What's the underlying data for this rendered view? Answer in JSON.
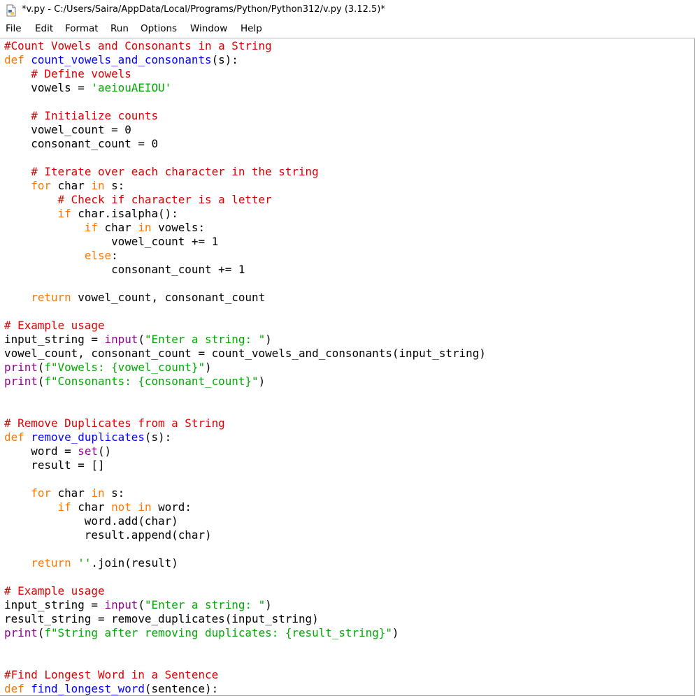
{
  "window": {
    "title": "*v.py - C:/Users/Saira/AppData/Local/Programs/Python/Python312/v.py (3.12.5)*",
    "icon": "python-file-icon"
  },
  "menu": {
    "items": [
      "File",
      "Edit",
      "Format",
      "Run",
      "Options",
      "Window",
      "Help"
    ]
  },
  "colors": {
    "keyword": "#ff7700",
    "comment": "#dd0000",
    "string": "#00aa00",
    "builtin": "#900090",
    "definition": "#0000ff",
    "text": "#000000"
  },
  "editor": {
    "lines": [
      [
        [
          "cm",
          "#Count Vowels and Consonants in a String"
        ]
      ],
      [
        [
          "kw",
          "def"
        ],
        [
          "pl",
          " "
        ],
        [
          "df",
          "count_vowels_and_consonants"
        ],
        [
          "pl",
          "(s):"
        ]
      ],
      [
        [
          "pl",
          "    "
        ],
        [
          "cm",
          "# Define vowels"
        ]
      ],
      [
        [
          "pl",
          "    vowels = "
        ],
        [
          "st",
          "'aeiouAEIOU'"
        ]
      ],
      [],
      [
        [
          "pl",
          "    "
        ],
        [
          "cm",
          "# Initialize counts"
        ]
      ],
      [
        [
          "pl",
          "    vowel_count = 0"
        ]
      ],
      [
        [
          "pl",
          "    consonant_count = 0"
        ]
      ],
      [],
      [
        [
          "pl",
          "    "
        ],
        [
          "cm",
          "# Iterate over each character in the string"
        ]
      ],
      [
        [
          "pl",
          "    "
        ],
        [
          "kw",
          "for"
        ],
        [
          "pl",
          " char "
        ],
        [
          "kw",
          "in"
        ],
        [
          "pl",
          " s:"
        ]
      ],
      [
        [
          "pl",
          "        "
        ],
        [
          "cm",
          "# Check if character is a letter"
        ]
      ],
      [
        [
          "pl",
          "        "
        ],
        [
          "kw",
          "if"
        ],
        [
          "pl",
          " char.isalpha():"
        ]
      ],
      [
        [
          "pl",
          "            "
        ],
        [
          "kw",
          "if"
        ],
        [
          "pl",
          " char "
        ],
        [
          "kw",
          "in"
        ],
        [
          "pl",
          " vowels:"
        ]
      ],
      [
        [
          "pl",
          "                vowel_count += 1"
        ]
      ],
      [
        [
          "pl",
          "            "
        ],
        [
          "kw",
          "else"
        ],
        [
          "pl",
          ":"
        ]
      ],
      [
        [
          "pl",
          "                consonant_count += 1"
        ]
      ],
      [],
      [
        [
          "pl",
          "    "
        ],
        [
          "kw",
          "return"
        ],
        [
          "pl",
          " vowel_count, consonant_count"
        ]
      ],
      [],
      [
        [
          "cm",
          "# Example usage"
        ]
      ],
      [
        [
          "pl",
          "input_string = "
        ],
        [
          "bi",
          "input"
        ],
        [
          "pl",
          "("
        ],
        [
          "st",
          "\"Enter a string: \""
        ],
        [
          "pl",
          ")"
        ]
      ],
      [
        [
          "pl",
          "vowel_count, consonant_count = count_vowels_and_consonants(input_string)"
        ]
      ],
      [
        [
          "bi",
          "print"
        ],
        [
          "pl",
          "("
        ],
        [
          "st",
          "f\"Vowels: {vowel_count}\""
        ],
        [
          "pl",
          ")"
        ]
      ],
      [
        [
          "bi",
          "print"
        ],
        [
          "pl",
          "("
        ],
        [
          "st",
          "f\"Consonants: {consonant_count}\""
        ],
        [
          "pl",
          ")"
        ]
      ],
      [],
      [],
      [
        [
          "cm",
          "# Remove Duplicates from a String"
        ]
      ],
      [
        [
          "kw",
          "def"
        ],
        [
          "pl",
          " "
        ],
        [
          "df",
          "remove_duplicates"
        ],
        [
          "pl",
          "(s):"
        ]
      ],
      [
        [
          "pl",
          "    word = "
        ],
        [
          "bi",
          "set"
        ],
        [
          "pl",
          "()"
        ]
      ],
      [
        [
          "pl",
          "    result = []"
        ]
      ],
      [],
      [
        [
          "pl",
          "    "
        ],
        [
          "kw",
          "for"
        ],
        [
          "pl",
          " char "
        ],
        [
          "kw",
          "in"
        ],
        [
          "pl",
          " s:"
        ]
      ],
      [
        [
          "pl",
          "        "
        ],
        [
          "kw",
          "if"
        ],
        [
          "pl",
          " char "
        ],
        [
          "kw",
          "not"
        ],
        [
          "pl",
          " "
        ],
        [
          "kw",
          "in"
        ],
        [
          "pl",
          " word:"
        ]
      ],
      [
        [
          "pl",
          "            word.add(char)"
        ]
      ],
      [
        [
          "pl",
          "            result.append(char)"
        ]
      ],
      [],
      [
        [
          "pl",
          "    "
        ],
        [
          "kw",
          "return"
        ],
        [
          "pl",
          " "
        ],
        [
          "st",
          "''"
        ],
        [
          "pl",
          ".join(result)"
        ]
      ],
      [],
      [
        [
          "cm",
          "# Example usage"
        ]
      ],
      [
        [
          "pl",
          "input_string = "
        ],
        [
          "bi",
          "input"
        ],
        [
          "pl",
          "("
        ],
        [
          "st",
          "\"Enter a string: \""
        ],
        [
          "pl",
          ")"
        ]
      ],
      [
        [
          "pl",
          "result_string = remove_duplicates(input_string)"
        ]
      ],
      [
        [
          "bi",
          "print"
        ],
        [
          "pl",
          "("
        ],
        [
          "st",
          "f\"String after removing duplicates: {result_string}\""
        ],
        [
          "pl",
          ")"
        ]
      ],
      [],
      [],
      [
        [
          "cm",
          "#Find Longest Word in a Sentence"
        ]
      ],
      [
        [
          "kw",
          "def"
        ],
        [
          "pl",
          " "
        ],
        [
          "df",
          "find_longest_word"
        ],
        [
          "pl",
          "(sentence):"
        ]
      ]
    ]
  }
}
